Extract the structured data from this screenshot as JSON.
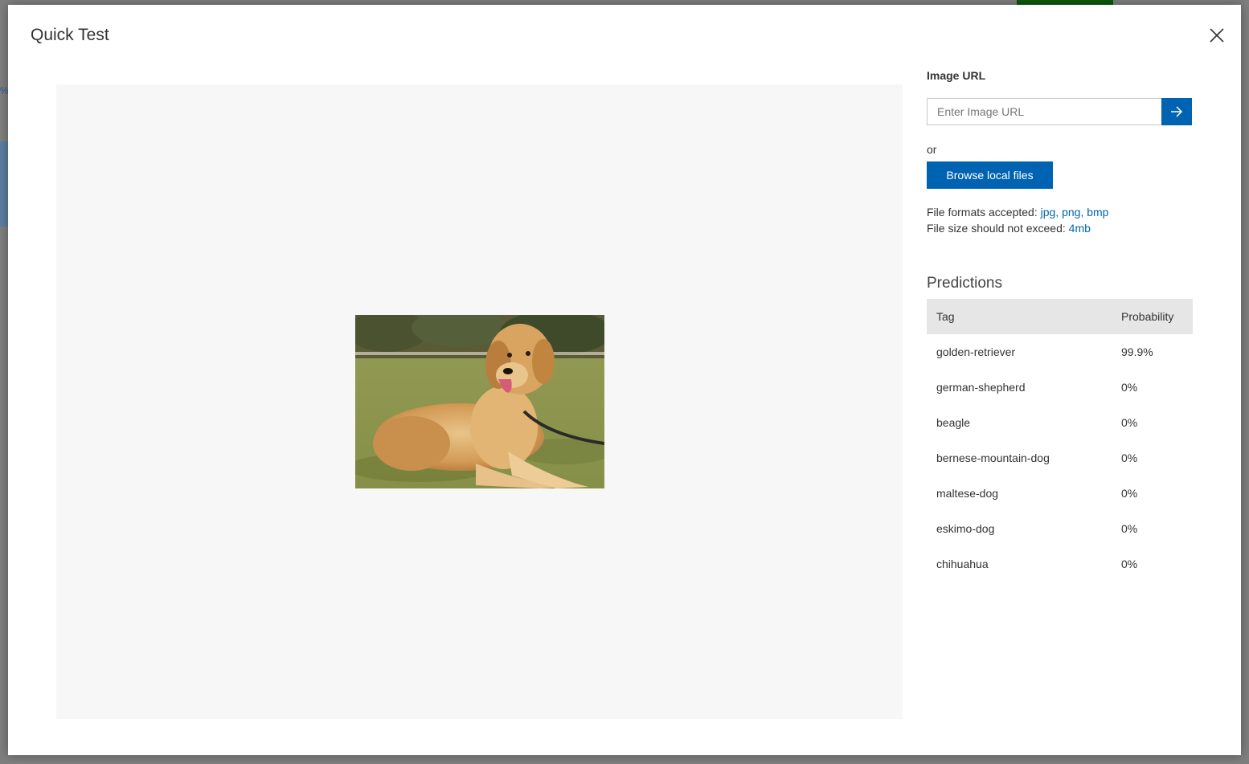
{
  "dialog": {
    "title": "Quick Test",
    "close_icon": "close-icon"
  },
  "preview": {
    "image_subject": "golden retriever lying on grass",
    "background_color": "#f7f7f7"
  },
  "image_url": {
    "label": "Image URL",
    "placeholder": "Enter Image URL",
    "value": "",
    "submit_icon": "arrow-right-icon"
  },
  "or_text": "or",
  "browse": {
    "label": "Browse local files"
  },
  "formats": {
    "prefix": "File formats accepted: ",
    "values": "jpg, png, bmp"
  },
  "size_limit": {
    "prefix": "File size should not exceed: ",
    "value": "4mb"
  },
  "predictions": {
    "title": "Predictions",
    "columns": [
      "Tag",
      "Probability"
    ],
    "rows": [
      {
        "tag": "golden-retriever",
        "probability": "99.9%"
      },
      {
        "tag": "german-shepherd",
        "probability": "0%"
      },
      {
        "tag": "beagle",
        "probability": "0%"
      },
      {
        "tag": "bernese-mountain-dog",
        "probability": "0%"
      },
      {
        "tag": "maltese-dog",
        "probability": "0%"
      },
      {
        "tag": "eskimo-dog",
        "probability": "0%"
      },
      {
        "tag": "chihuahua",
        "probability": "0%"
      }
    ]
  },
  "colors": {
    "accent": "#0063b1",
    "header_bg": "#e6e6e6",
    "text": "#333333"
  }
}
